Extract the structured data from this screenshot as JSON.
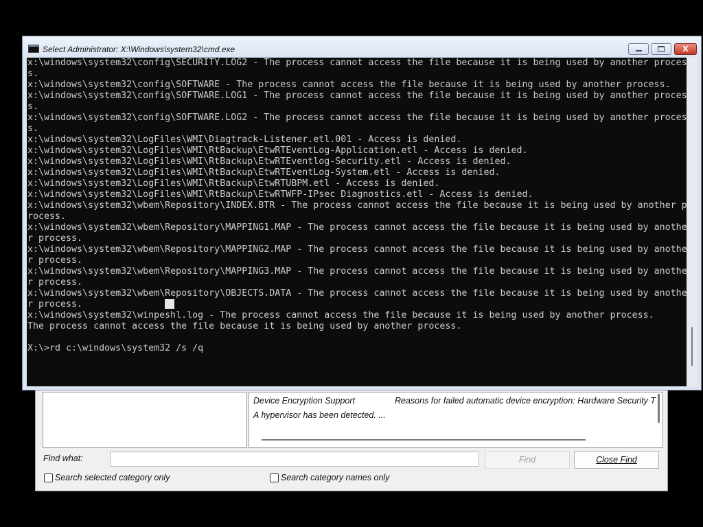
{
  "cmd_window": {
    "title": "Select Administrator: X:\\Windows\\system32\\cmd.exe",
    "buttons": {
      "minimize": "—",
      "maximize": "□",
      "close": "X"
    },
    "lines": [
      "x:\\windows\\system32\\config\\SECURITY.LOG2 - The process cannot access the file because it is being used by another proces",
      "s.",
      "x:\\windows\\system32\\config\\SOFTWARE - The process cannot access the file because it is being used by another process.",
      "x:\\windows\\system32\\config\\SOFTWARE.LOG1 - The process cannot access the file because it is being used by another proces",
      "s.",
      "x:\\windows\\system32\\config\\SOFTWARE.LOG2 - The process cannot access the file because it is being used by another proces",
      "s.",
      "x:\\windows\\system32\\LogFiles\\WMI\\Diagtrack-Listener.etl.001 - Access is denied.",
      "x:\\windows\\system32\\LogFiles\\WMI\\RtBackup\\EtwRTEventLog-Application.etl - Access is denied.",
      "x:\\windows\\system32\\LogFiles\\WMI\\RtBackup\\EtwRTEventlog-Security.etl - Access is denied.",
      "x:\\windows\\system32\\LogFiles\\WMI\\RtBackup\\EtwRTEventLog-System.etl - Access is denied.",
      "x:\\windows\\system32\\LogFiles\\WMI\\RtBackup\\EtwRTUBPM.etl - Access is denied.",
      "x:\\windows\\system32\\LogFiles\\WMI\\RtBackup\\EtwRTWFP-IPsec Diagnostics.etl - Access is denied.",
      "x:\\windows\\system32\\wbem\\Repository\\INDEX.BTR - The process cannot access the file because it is being used by another p",
      "rocess.",
      "x:\\windows\\system32\\wbem\\Repository\\MAPPING1.MAP - The process cannot access the file because it is being used by anothe",
      "r process.",
      "x:\\windows\\system32\\wbem\\Repository\\MAPPING2.MAP - The process cannot access the file because it is being used by anothe",
      "r process.",
      "x:\\windows\\system32\\wbem\\Repository\\MAPPING3.MAP - The process cannot access the file because it is being used by anothe",
      "r process.",
      "x:\\windows\\system32\\wbem\\Repository\\OBJECTS.DATA - The process cannot access the file because it is being used by anothe",
      "r process.",
      "x:\\windows\\system32\\winpeshl.log - The process cannot access the file because it is being used by another process.",
      "The process cannot access the file because it is being used by another process.",
      "",
      "X:\\>rd c:\\windows\\system32 /s /q"
    ]
  },
  "sysinfo_window": {
    "rows": [
      {
        "item": "Device Encryption Support",
        "value": "Reasons for failed automatic device encryption: Hardware Security T"
      },
      {
        "item": "A hypervisor has been detected. ...",
        "value": ""
      }
    ],
    "find_label": "Find what:",
    "find_value": "",
    "find_button": "Find",
    "close_find_button": "Close Find",
    "checkbox_selected_category": "Search selected category only",
    "checkbox_category_names": "Search category names only"
  }
}
